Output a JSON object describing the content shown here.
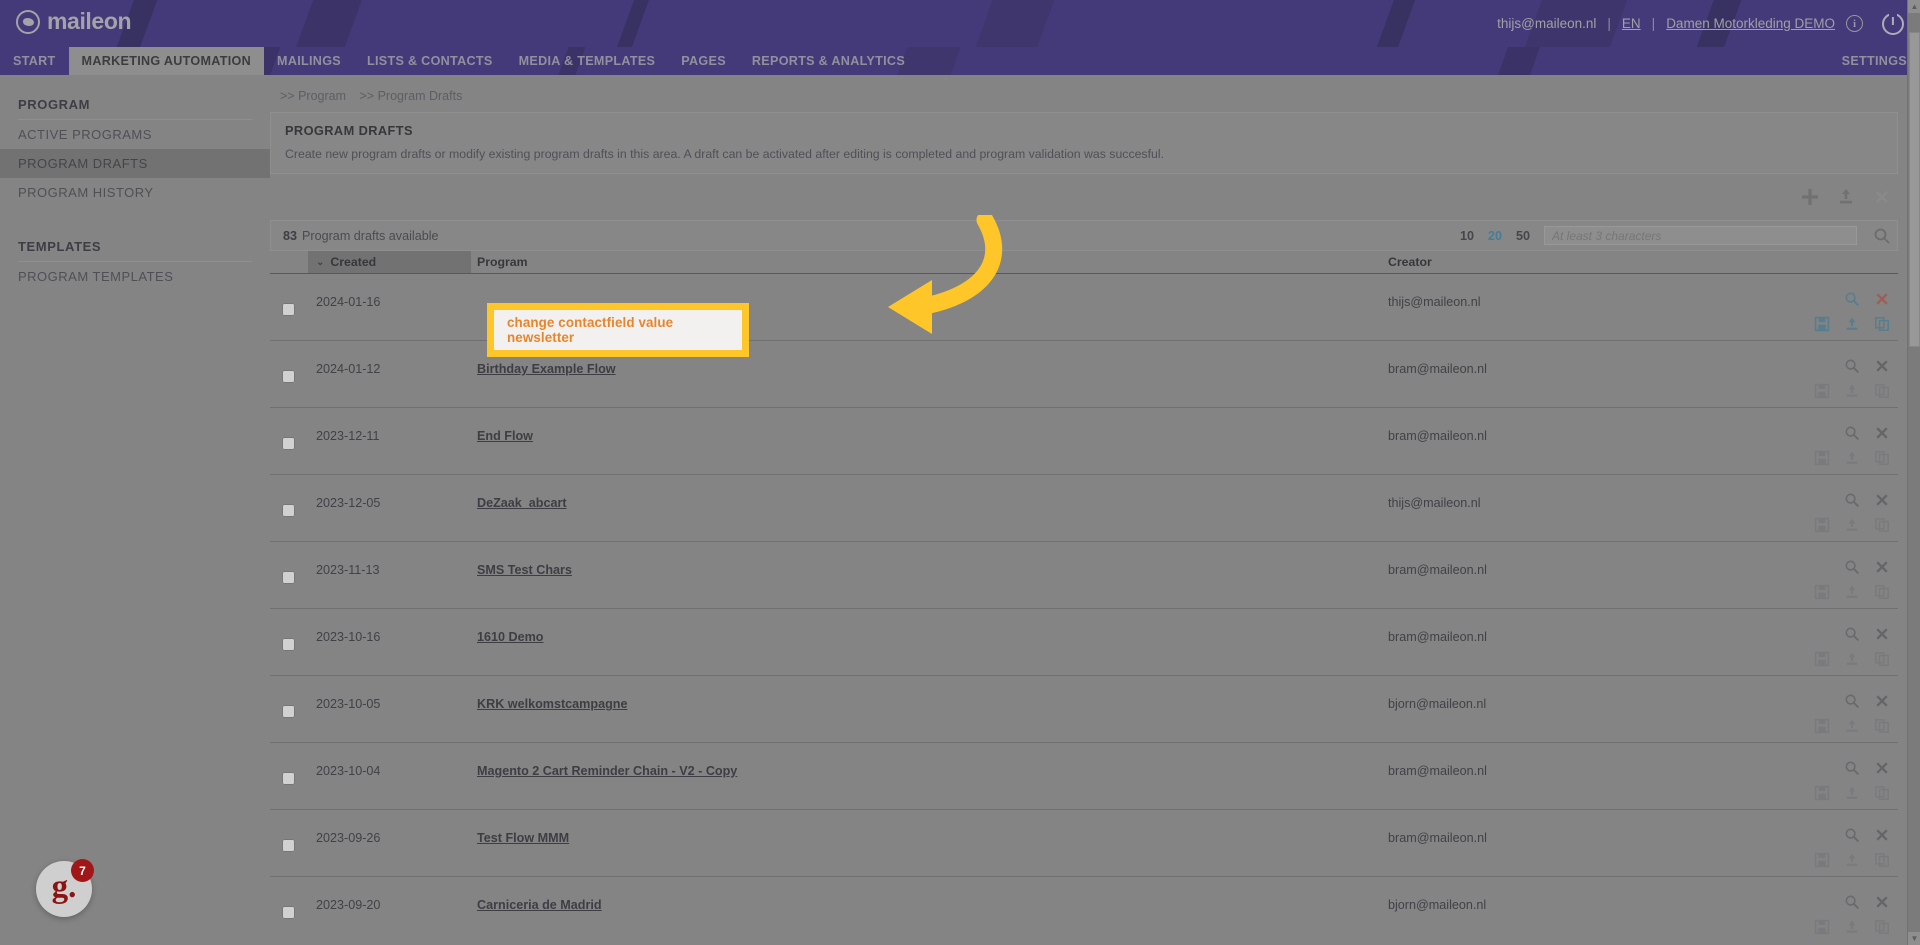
{
  "header": {
    "logo_text": "maileon",
    "user_email": "thijs@maileon.nl",
    "sep": "|",
    "language": "EN",
    "account": "Damen Motorkleding DEMO",
    "info_icon": "i",
    "icons": {
      "info": "info-icon",
      "power": "power-icon"
    }
  },
  "nav": {
    "items": [
      {
        "label": "START",
        "active": false
      },
      {
        "label": "MARKETING AUTOMATION",
        "active": true
      },
      {
        "label": "MAILINGS",
        "active": false
      },
      {
        "label": "LISTS & CONTACTS",
        "active": false
      },
      {
        "label": "MEDIA & TEMPLATES",
        "active": false
      },
      {
        "label": "PAGES",
        "active": false
      },
      {
        "label": "REPORTS & ANALYTICS",
        "active": false
      }
    ],
    "settings": "SETTINGS"
  },
  "sidebar": {
    "group1_title": "PROGRAM",
    "group1_items": [
      {
        "label": "ACTIVE PROGRAMS",
        "active": false
      },
      {
        "label": "PROGRAM DRAFTS",
        "active": true
      },
      {
        "label": "PROGRAM HISTORY",
        "active": false
      }
    ],
    "group2_title": "TEMPLATES",
    "group2_items": [
      {
        "label": "PROGRAM TEMPLATES",
        "active": false
      }
    ]
  },
  "breadcrumb": {
    "item1": ">> Program",
    "item2": ">> Program Drafts"
  },
  "panel": {
    "title": "PROGRAM DRAFTS",
    "description": "Create new program drafts or modify existing program drafts in this area. A draft can be activated after editing is completed and program validation was succesful."
  },
  "toolbar": {
    "add_icon": "plus-icon",
    "import_icon": "upload-icon",
    "delete_icon": "close-icon"
  },
  "list_meta": {
    "count": "83",
    "count_label": "Program drafts available",
    "page_sizes": [
      "10",
      "20",
      "50"
    ],
    "active_page_size": "20",
    "search_placeholder": "At least 3 characters",
    "search_value": ""
  },
  "table": {
    "columns": {
      "created": "Created",
      "program": "Program",
      "creator": "Creator"
    },
    "sort_caret": "⌄",
    "rows": [
      {
        "date": "2024-01-16",
        "program": "change contactfield value newsletter",
        "creator": "thijs@maileon.nl",
        "highlighted": true
      },
      {
        "date": "2024-01-12",
        "program": "Birthday Example Flow",
        "creator": "bram@maileon.nl",
        "highlighted": false
      },
      {
        "date": "2023-12-11",
        "program": "End Flow",
        "creator": "bram@maileon.nl",
        "highlighted": false
      },
      {
        "date": "2023-12-05",
        "program": "DeZaak_abcart",
        "creator": "thijs@maileon.nl",
        "highlighted": false
      },
      {
        "date": "2023-11-13",
        "program": "SMS Test Chars",
        "creator": "bram@maileon.nl",
        "highlighted": false
      },
      {
        "date": "2023-10-16",
        "program": "1610 Demo",
        "creator": "bram@maileon.nl",
        "highlighted": false
      },
      {
        "date": "2023-10-05",
        "program": "KRK welkomstcampagne",
        "creator": "bjorn@maileon.nl",
        "highlighted": false
      },
      {
        "date": "2023-10-04",
        "program": "Magento 2 Cart Reminder Chain - V2 - Copy",
        "creator": "bram@maileon.nl",
        "highlighted": false
      },
      {
        "date": "2023-09-26",
        "program": "Test Flow MMM",
        "creator": "bram@maileon.nl",
        "highlighted": false
      },
      {
        "date": "2023-09-20",
        "program": "Carniceria de Madrid",
        "creator": "bjorn@maileon.nl",
        "highlighted": false
      }
    ],
    "row_actions": {
      "preview": "magnifier-icon",
      "delete": "close-icon",
      "save": "save-icon",
      "export": "download-icon",
      "copy": "copy-icon"
    }
  },
  "annotation": {
    "callout_text": "change contactfield value newsletter",
    "callout_border_color": "#ffc629",
    "callout_text_color": "#e8852b",
    "arrow_color": "#ffc629"
  },
  "helper_widget": {
    "letter": "g.",
    "badge_count": "7"
  },
  "colors": {
    "header_bg": "#2a1a7a",
    "page_bg": "#8a8a8a",
    "accent_link": "#2b7fa8",
    "delete_red": "#b03a2e"
  }
}
